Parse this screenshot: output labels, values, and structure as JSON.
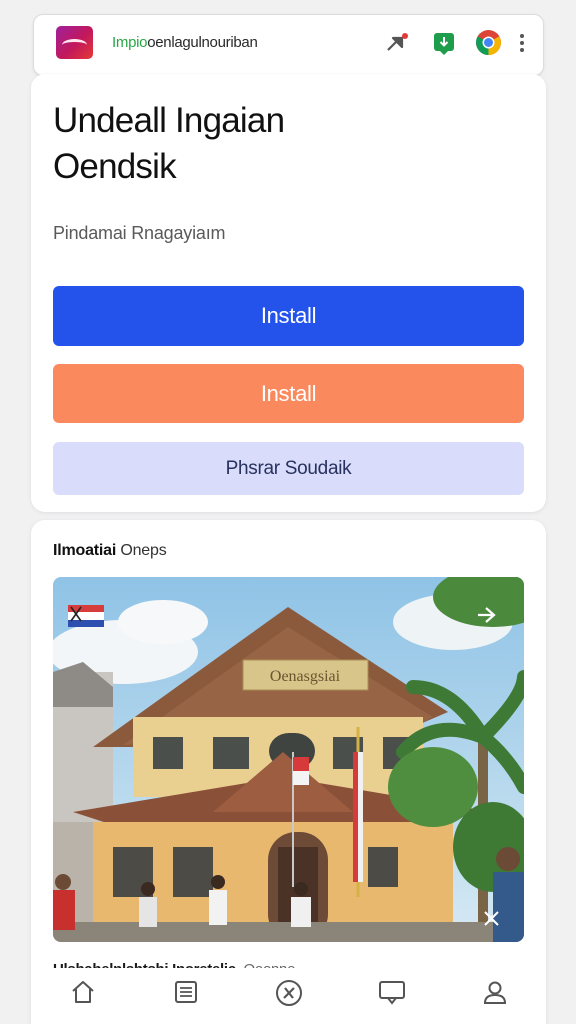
{
  "browser": {
    "url_prefix": "Impio",
    "url_rest": "oenlagulnouriban"
  },
  "hero": {
    "title_line1": "Undeall Ingaian",
    "title_line2": "Oendsik",
    "subtitle": "Pindamai Rnagayiaım"
  },
  "buttons": {
    "install_primary": "Install",
    "install_secondary": "Install",
    "tertiary": "Phsrar Soudaik"
  },
  "feed": {
    "heading_bold": "Ilmoatiai",
    "heading_rest": " Oneps",
    "photo_sign": "Oenasgsiai",
    "caption_bold": "Ulshahelnlshtshi Inoretelic",
    "caption_muted": "Oeonne"
  },
  "colors": {
    "primary": "#2453ec",
    "orange": "#fa8a5e",
    "light": "#d9dcfb"
  },
  "nav": {
    "items": [
      "home-icon",
      "article-icon",
      "explore-icon",
      "chat-icon",
      "profile-icon"
    ]
  }
}
